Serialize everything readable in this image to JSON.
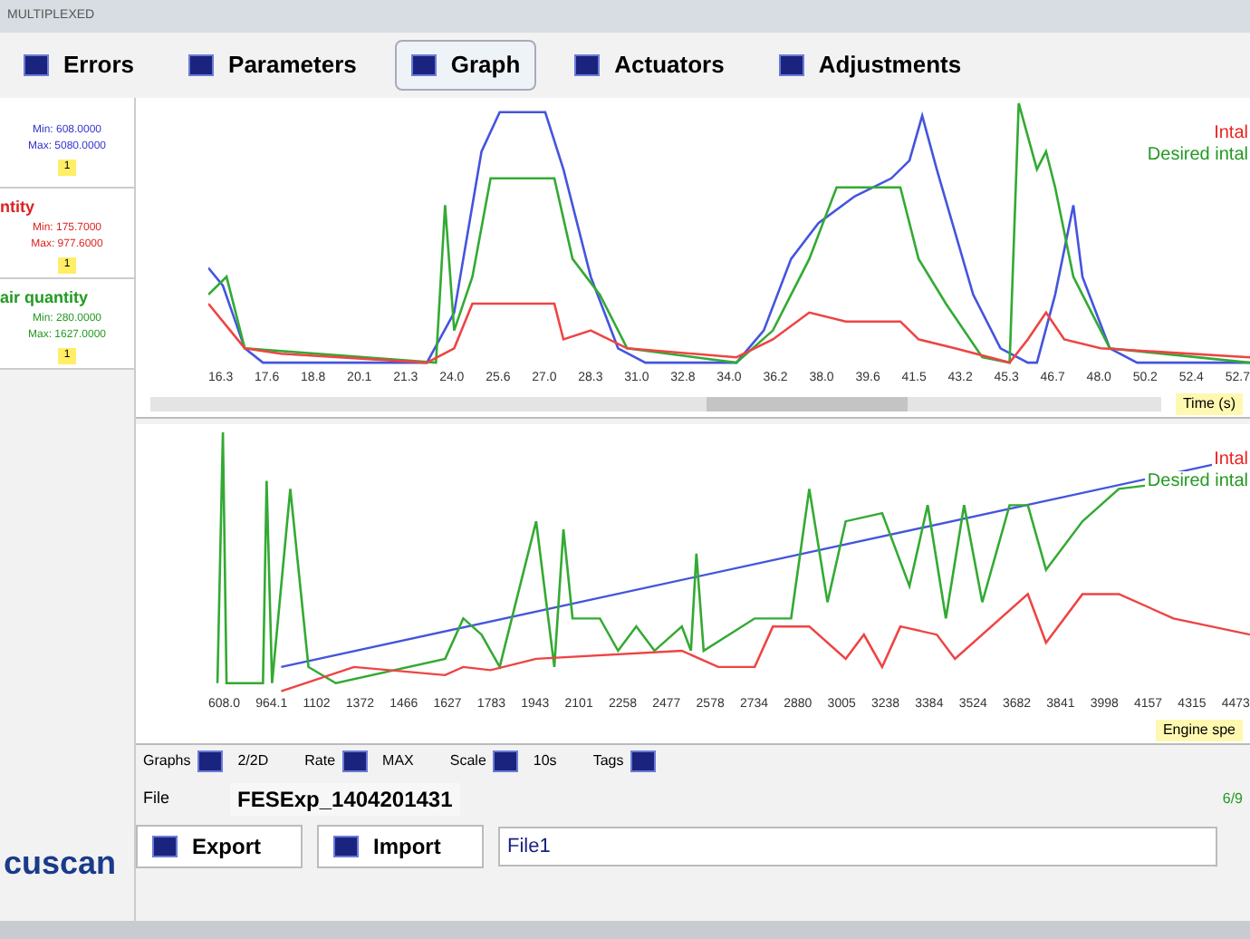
{
  "window": {
    "title": "MULTIPLEXED"
  },
  "tabs": [
    {
      "label": "Errors",
      "selected": false
    },
    {
      "label": "Parameters",
      "selected": false
    },
    {
      "label": "Graph",
      "selected": true
    },
    {
      "label": "Actuators",
      "selected": false
    },
    {
      "label": "Adjustments",
      "selected": false
    }
  ],
  "parameters": [
    {
      "min": "Min: 608.0000",
      "max": "Max: 5080.0000",
      "color": "#3333cc",
      "badge": "1"
    },
    {
      "name": "ntity",
      "min": "Min: 175.7000",
      "max": "Max: 977.6000",
      "color": "#dd2222",
      "badge": "1"
    },
    {
      "name": "air quantity",
      "min": "Min: 280.0000",
      "max": "Max: 1627.0000",
      "color": "#229922",
      "badge": "1"
    }
  ],
  "top_graph": {
    "legend": [
      {
        "label": "Intal",
        "color": "#ee2222"
      },
      {
        "label": "Desired intal",
        "color": "#229922"
      }
    ],
    "x_labels": [
      "16.3",
      "17.6",
      "18.8",
      "20.1",
      "21.3",
      "24.0",
      "25.6",
      "27.0",
      "28.3",
      "31.0",
      "32.8",
      "34.0",
      "36.2",
      "38.0",
      "39.6",
      "41.5",
      "43.2",
      "45.3",
      "46.7",
      "48.0",
      "50.2",
      "52.4",
      "52.7"
    ],
    "axis_title": "Time (s)"
  },
  "bottom_graph": {
    "legend": [
      {
        "label": "Intal",
        "color": "#ee2222"
      },
      {
        "label": "Desired intal",
        "color": "#229922"
      }
    ],
    "x_labels": [
      "608.0",
      "964.1",
      "1102",
      "1372",
      "1466",
      "1627",
      "1783",
      "1943",
      "2101",
      "2258",
      "2477",
      "2578",
      "2734",
      "2880",
      "3005",
      "3238",
      "3384",
      "3524",
      "3682",
      "3841",
      "3998",
      "4157",
      "4315",
      "4473"
    ],
    "axis_title": "Engine spe"
  },
  "controls": [
    {
      "label": "Graphs",
      "value": "2/2D"
    },
    {
      "label": "Rate",
      "value": "MAX"
    },
    {
      "label": "Scale",
      "value": "10s"
    },
    {
      "label": "Tags"
    }
  ],
  "file": {
    "label": "File",
    "value": "FESExp_1404201431",
    "count": "6/9"
  },
  "buttons": [
    "Export",
    "Import"
  ],
  "name_field": {
    "value": "File1"
  },
  "logo": "cuscan"
}
